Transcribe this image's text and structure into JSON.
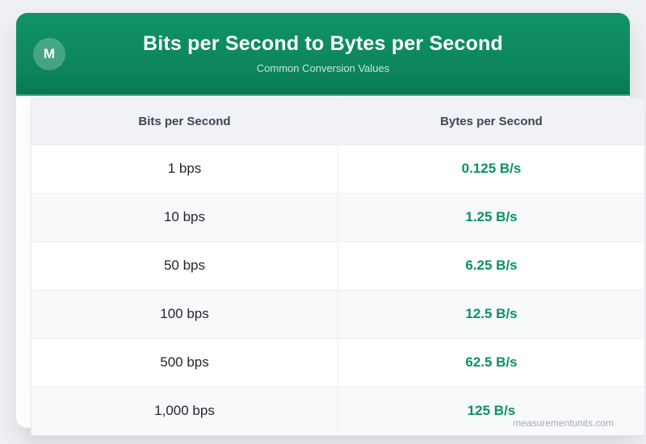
{
  "header": {
    "badge_letter": "M",
    "title": "Bits per Second to Bytes per Second",
    "subtitle": "Common Conversion Values"
  },
  "table": {
    "columns": [
      "Bits per Second",
      "Bytes per Second"
    ],
    "rows": [
      {
        "bits": "1 bps",
        "bytes": "0.125 B/s"
      },
      {
        "bits": "10 bps",
        "bytes": "1.25 B/s"
      },
      {
        "bits": "50 bps",
        "bytes": "6.25 B/s"
      },
      {
        "bits": "100 bps",
        "bytes": "12.5 B/s"
      },
      {
        "bits": "500 bps",
        "bytes": "62.5 B/s"
      },
      {
        "bits": "1,000 bps",
        "bytes": "125 B/s"
      }
    ]
  },
  "watermark": "measurementunits.com",
  "colors": {
    "header_green_top": "#109467",
    "header_green_bottom": "#077a51",
    "value_green": "#0b9161",
    "page_bg": "#eff1f4",
    "table_header_bg": "#f1f2f5",
    "row_alt_bg": "#f8f9fb",
    "header_text": "#3d4657"
  },
  "chart_data": {
    "type": "table",
    "title": "Bits per Second to Bytes per Second",
    "subtitle": "Common Conversion Values",
    "columns": [
      "Bits per Second",
      "Bytes per Second"
    ],
    "rows": [
      [
        "1 bps",
        "0.125 B/s"
      ],
      [
        "10 bps",
        "1.25 B/s"
      ],
      [
        "50 bps",
        "6.25 B/s"
      ],
      [
        "100 bps",
        "12.5 B/s"
      ],
      [
        "500 bps",
        "62.5 B/s"
      ],
      [
        "1,000 bps",
        "125 B/s"
      ]
    ],
    "bits_per_second": [
      1,
      10,
      50,
      100,
      500,
      1000
    ],
    "bytes_per_second": [
      0.125,
      1.25,
      6.25,
      12.5,
      62.5,
      125
    ]
  }
}
